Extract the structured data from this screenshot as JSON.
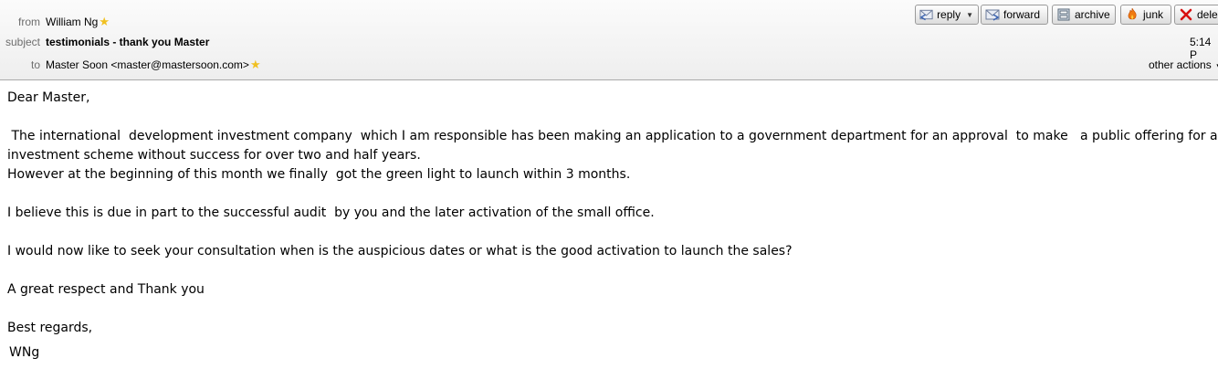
{
  "header": {
    "from_label": "from",
    "from_value": "William Ng",
    "subject_label": "subject",
    "subject_value": "testimonials - thank you Master",
    "to_label": "to",
    "to_value": "Master Soon <master@mastersoon.com>",
    "time": "5:14 P",
    "other_actions": "other actions"
  },
  "toolbar": {
    "reply": "reply",
    "forward": "forward",
    "archive": "archive",
    "junk": "junk",
    "delete": "dele"
  },
  "message": {
    "greeting": "Dear Master,",
    "para1_line1": " The international  development investment company  which I am responsible has been making an application to a government department for an approval  to make   a public offering for an",
    "para1_line2": "investment scheme without success for over two and half years.",
    "para1_line3": "However at the beginning of this month we finally  got the green light to launch within 3 months.",
    "para2": "I believe this is due in part to the successful audit  by you and the later activation of the small office.",
    "para3": "I would now like to seek your consultation when is the auspicious dates or what is the good activation to launch the sales?",
    "para4": "A great respect and Thank you",
    "closing": "Best regards,",
    "signature": "WNg"
  },
  "colors": {
    "star": "#f0c020",
    "delete_icon": "#d81010",
    "junk_icon": "#f07a10"
  }
}
